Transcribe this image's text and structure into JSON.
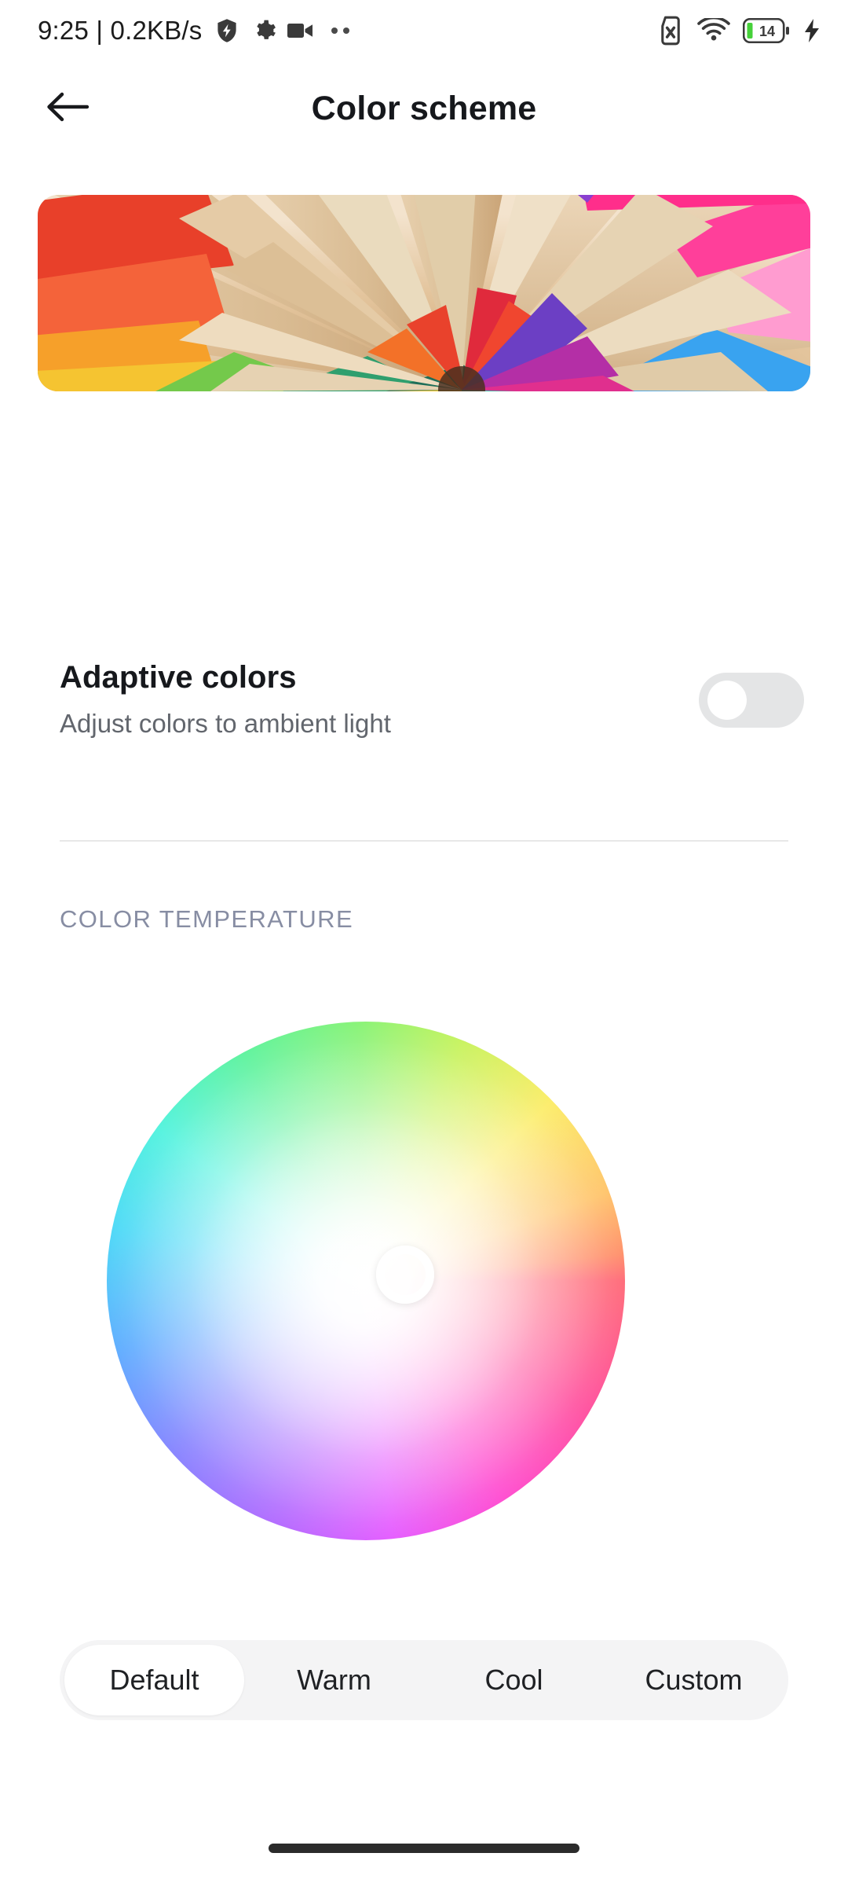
{
  "status_bar": {
    "clock": "9:25 | 0.2KB/s",
    "left_icons": [
      "shield-bolt-icon",
      "gear-icon",
      "video-camera-icon",
      "two-dots-icon"
    ],
    "right_icons": [
      "sim-card-off-icon",
      "wifi-icon",
      "battery-icon",
      "charging-bolt-icon"
    ],
    "battery_level": "14",
    "battery_fill_color": "#46d13a",
    "icon_color": "#3a3a3a"
  },
  "app_bar": {
    "back_icon": "arrow-left-icon",
    "title": "Color scheme"
  },
  "banner": {
    "alt": "colored pencils arranged in a radial fan",
    "corner_radius": "26px"
  },
  "adaptive": {
    "title": "Adaptive colors",
    "subtitle": "Adjust colors to ambient light",
    "toggle_state": "off",
    "toggle_track_color": "#e4e5e6",
    "toggle_knob_color": "#ffffff"
  },
  "section": {
    "color_temperature_label": "COLOR TEMPERATURE",
    "label_color": "#878da3"
  },
  "color_wheel": {
    "name": "color-temperature-wheel",
    "handle_state": "centered",
    "handle_color": "#ffffff"
  },
  "presets": {
    "selected_index": 0,
    "items": [
      {
        "label": "Default"
      },
      {
        "label": "Warm"
      },
      {
        "label": "Cool"
      },
      {
        "label": "Custom"
      }
    ],
    "track_color": "#f4f4f5",
    "selected_color": "#ffffff"
  },
  "nav": {
    "gesture_bar_color": "#2b2b2b"
  }
}
